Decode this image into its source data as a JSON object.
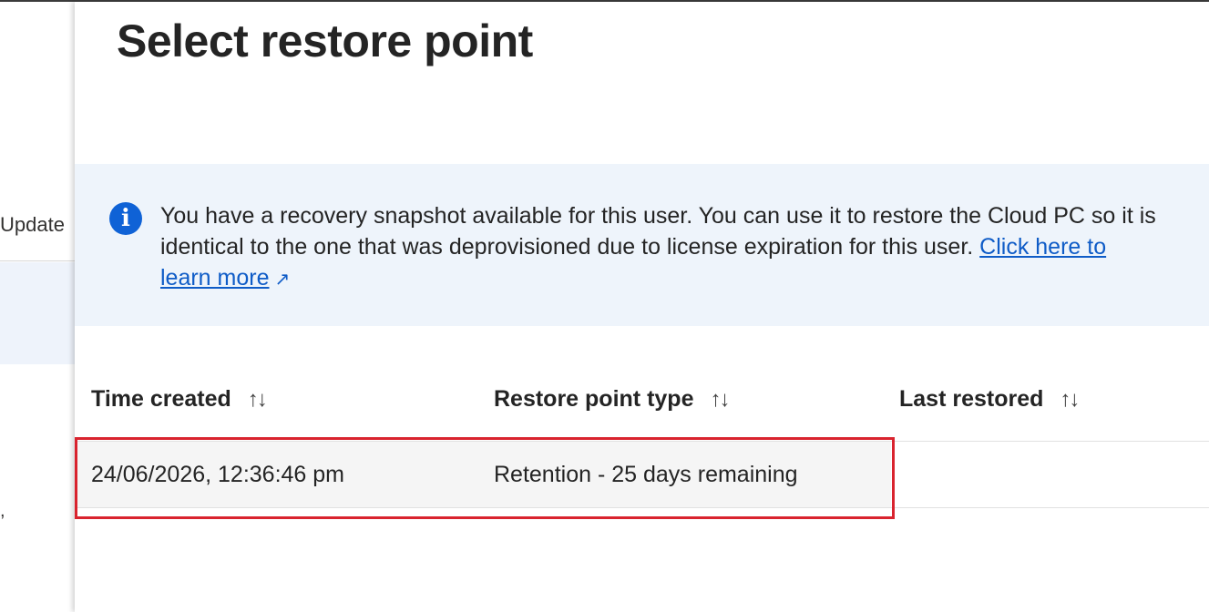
{
  "background": {
    "partial_label": "Update",
    "partial_comma": ","
  },
  "panel": {
    "title": "Select restore point",
    "info": {
      "icon": "info-icon",
      "line1": "You have a recovery snapshot available for this user. You can use it to restore the Cloud PC so it is",
      "line2_text": "identical to the one that was deprovisioned due to license expiration for this user. ",
      "line2_link": "Click here to",
      "line3_link": "learn more",
      "external_icon": "external-link-icon"
    },
    "table": {
      "columns": [
        {
          "label": "Time created",
          "sort_icon": "↑↓"
        },
        {
          "label": "Restore point type",
          "sort_icon": "↑↓"
        },
        {
          "label": "Last restored",
          "sort_icon": "↑↓"
        }
      ],
      "rows": [
        {
          "time_created": "24/06/2026, 12:36:46 pm",
          "restore_point_type": "Retention - 25 days remaining",
          "last_restored": ""
        }
      ]
    }
  },
  "colors": {
    "accent": "#0f62d6",
    "info_background": "#eef4fb",
    "highlight_border": "#d9232e",
    "link": "#0f5cc7"
  }
}
